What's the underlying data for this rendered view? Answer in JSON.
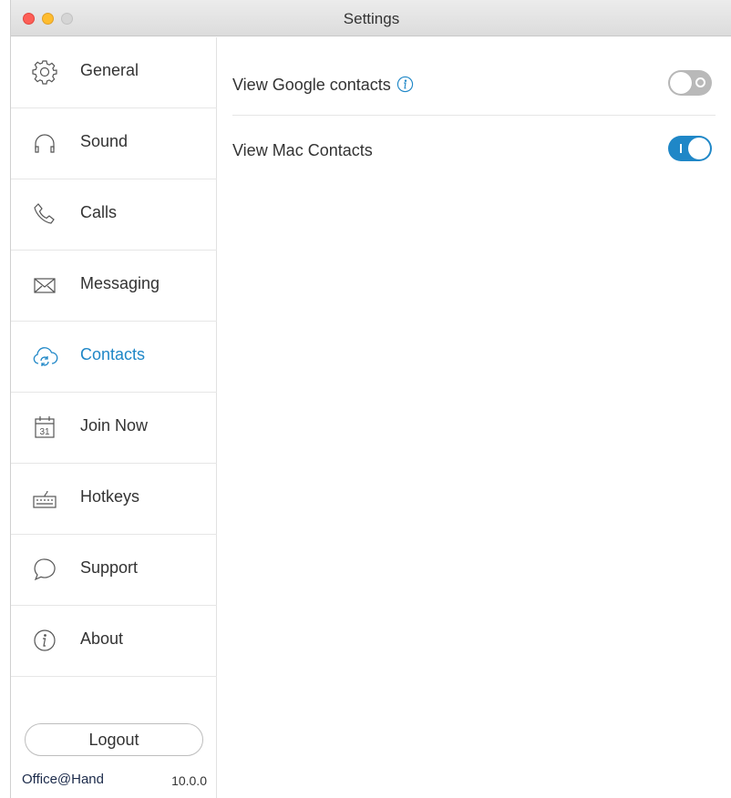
{
  "window": {
    "title": "Settings"
  },
  "sidebar": {
    "items": [
      {
        "label": "General",
        "icon": "gear-icon"
      },
      {
        "label": "Sound",
        "icon": "headphones-icon"
      },
      {
        "label": "Calls",
        "icon": "phone-icon"
      },
      {
        "label": "Messaging",
        "icon": "envelope-icon"
      },
      {
        "label": "Contacts",
        "icon": "contacts-cloud-icon",
        "active": true
      },
      {
        "label": "Join Now",
        "icon": "calendar-icon"
      },
      {
        "label": "Hotkeys",
        "icon": "keyboard-icon"
      },
      {
        "label": "Support",
        "icon": "speech-bubble-icon"
      },
      {
        "label": "About",
        "icon": "info-icon"
      }
    ],
    "logout_label": "Logout",
    "brand": "Office@Hand",
    "version": "10.0.0"
  },
  "contacts_settings": {
    "google": {
      "label": "View Google contacts",
      "enabled": false
    },
    "mac": {
      "label": "View Mac Contacts",
      "enabled": true
    }
  },
  "colors": {
    "accent": "#1f87c7",
    "toggle_off": "#b9b9b9"
  }
}
